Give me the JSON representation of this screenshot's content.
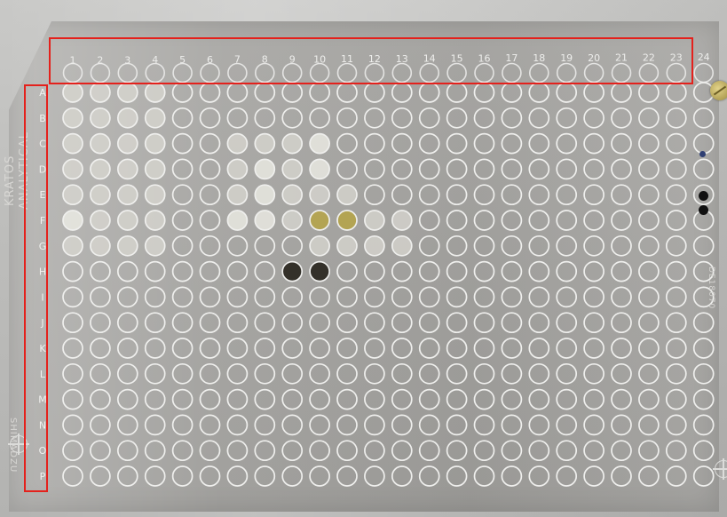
{
  "scene": {
    "description_label": "",
    "brand_lines": [
      "KRATOS",
      "ANALYTICAL"
    ],
    "bottom_left_text": "SHIMADZU",
    "right_side_text": "DE18070"
  },
  "plate": {
    "columns": [
      "1",
      "2",
      "3",
      "4",
      "5",
      "6",
      "7",
      "8",
      "9",
      "10",
      "11",
      "12",
      "13",
      "14",
      "15",
      "16",
      "17",
      "18",
      "19",
      "20",
      "21",
      "22",
      "23",
      "24"
    ],
    "rows": [
      "A",
      "B",
      "C",
      "D",
      "E",
      "F",
      "G",
      "H",
      "I",
      "J",
      "K",
      "L",
      "M",
      "N",
      "O",
      "P"
    ]
  },
  "annotations": {
    "highlight_color": "#e4211c",
    "highlight_top": "column numbers",
    "highlight_left": "row letters"
  },
  "colors": {
    "well_ring": "#efefed",
    "filled_pale": "#d9d8d2",
    "filled_bright": "#f2f1ea",
    "filled_yellow": "#b8a43a",
    "filled_dark": "#2e2b24"
  },
  "samples": [
    {
      "cell": "A1",
      "tone": "pale"
    },
    {
      "cell": "A2",
      "tone": "pale"
    },
    {
      "cell": "A3",
      "tone": "pale"
    },
    {
      "cell": "A4",
      "tone": "pale"
    },
    {
      "cell": "B1",
      "tone": "pale"
    },
    {
      "cell": "B2",
      "tone": "pale"
    },
    {
      "cell": "B3",
      "tone": "pale"
    },
    {
      "cell": "B4",
      "tone": "pale"
    },
    {
      "cell": "C1",
      "tone": "pale"
    },
    {
      "cell": "C2",
      "tone": "pale"
    },
    {
      "cell": "C3",
      "tone": "pale"
    },
    {
      "cell": "C4",
      "tone": "pale"
    },
    {
      "cell": "C7",
      "tone": "pale"
    },
    {
      "cell": "C8",
      "tone": "pale"
    },
    {
      "cell": "C9",
      "tone": "pale"
    },
    {
      "cell": "C10",
      "tone": "bright"
    },
    {
      "cell": "D1",
      "tone": "pale"
    },
    {
      "cell": "D2",
      "tone": "pale"
    },
    {
      "cell": "D3",
      "tone": "pale"
    },
    {
      "cell": "D4",
      "tone": "pale"
    },
    {
      "cell": "D7",
      "tone": "pale"
    },
    {
      "cell": "D8",
      "tone": "bright"
    },
    {
      "cell": "D9",
      "tone": "pale"
    },
    {
      "cell": "D10",
      "tone": "bright"
    },
    {
      "cell": "E1",
      "tone": "pale"
    },
    {
      "cell": "E2",
      "tone": "pale"
    },
    {
      "cell": "E3",
      "tone": "pale"
    },
    {
      "cell": "E4",
      "tone": "pale"
    },
    {
      "cell": "E7",
      "tone": "pale"
    },
    {
      "cell": "E8",
      "tone": "bright"
    },
    {
      "cell": "E9",
      "tone": "pale"
    },
    {
      "cell": "E10",
      "tone": "pale"
    },
    {
      "cell": "E11",
      "tone": "pale"
    },
    {
      "cell": "F1",
      "tone": "bright"
    },
    {
      "cell": "F2",
      "tone": "pale"
    },
    {
      "cell": "F3",
      "tone": "pale"
    },
    {
      "cell": "F4",
      "tone": "pale"
    },
    {
      "cell": "F7",
      "tone": "bright"
    },
    {
      "cell": "F8",
      "tone": "bright"
    },
    {
      "cell": "F9",
      "tone": "pale"
    },
    {
      "cell": "F10",
      "tone": "yellow"
    },
    {
      "cell": "F11",
      "tone": "yellow"
    },
    {
      "cell": "F12",
      "tone": "pale"
    },
    {
      "cell": "F13",
      "tone": "pale"
    },
    {
      "cell": "G1",
      "tone": "pale"
    },
    {
      "cell": "G2",
      "tone": "pale"
    },
    {
      "cell": "G3",
      "tone": "pale"
    },
    {
      "cell": "G4",
      "tone": "pale"
    },
    {
      "cell": "G10",
      "tone": "pale"
    },
    {
      "cell": "G11",
      "tone": "pale"
    },
    {
      "cell": "G12",
      "tone": "pale"
    },
    {
      "cell": "G13",
      "tone": "pale"
    },
    {
      "cell": "H9",
      "tone": "dark"
    },
    {
      "cell": "H10",
      "tone": "dark"
    }
  ]
}
